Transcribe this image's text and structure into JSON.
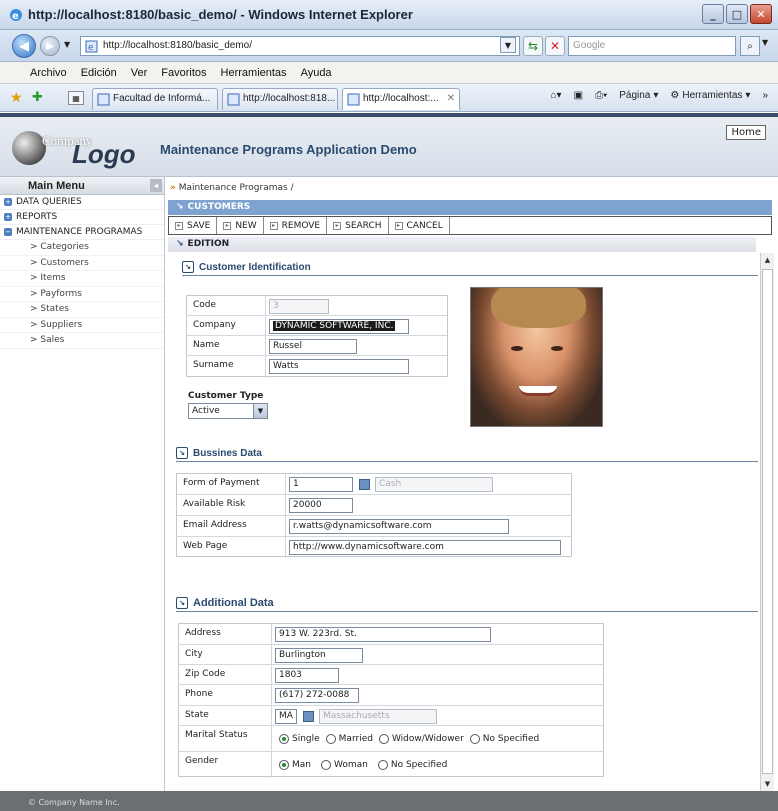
{
  "window": {
    "title": "http://localhost:8180/basic_demo/ - Windows Internet Explorer",
    "url": "http://localhost:8180/basic_demo/",
    "search_placeholder": "Google"
  },
  "menubar": [
    "Archivo",
    "Edición",
    "Ver",
    "Favoritos",
    "Herramientas",
    "Ayuda"
  ],
  "tabs": [
    {
      "label": "Facultad de Informá..."
    },
    {
      "label": "http://localhost:818..."
    },
    {
      "label": "http://localhost:..."
    }
  ],
  "toolbar_right": {
    "page": "Página",
    "tools": "Herramientas"
  },
  "app": {
    "logo_company": "Company",
    "logo_text": "Logo",
    "title": "Maintenance Programs Application Demo",
    "home": "Home",
    "footer": "© Company Name Inc."
  },
  "sidebar": {
    "header": "Main Menu",
    "items": [
      "DATA QUERIES",
      "REPORTS",
      "MAINTENANCE PROGRAMAS"
    ],
    "sub_items": [
      "> Categories",
      "> Customers",
      "> Items",
      "> Payforms",
      "> States",
      "> Suppliers",
      "> Sales"
    ]
  },
  "main": {
    "breadcrumb_arrows": "»",
    "breadcrumb": "Maintenance Programas /",
    "section": "CUSTOMERS",
    "buttons": [
      "SAVE",
      "NEW",
      "REMOVE",
      "SEARCH",
      "CANCEL"
    ],
    "edition": "EDITION"
  },
  "customer_identification": {
    "title": "Customer Identification",
    "code_label": "Code",
    "code": "3",
    "company_label": "Company",
    "company": "DYNAMIC SOFTWARE, INC.",
    "name_label": "Name",
    "name": "Russel",
    "surname_label": "Surname",
    "surname": "Watts",
    "type_label": "Customer Type",
    "type": "Active"
  },
  "business_data": {
    "title": "Bussines Data",
    "payment_label": "Form of Payment",
    "payment_code": "1",
    "payment_desc": "Cash",
    "risk_label": "Available Risk",
    "risk": "20000",
    "email_label": "Email Address",
    "email": "r.watts@dynamicsoftware.com",
    "web_label": "Web Page",
    "web": "http://www.dynamicsoftware.com"
  },
  "additional_data": {
    "title": "Additional Data",
    "address_label": "Address",
    "address": "913 W. 223rd. St.",
    "city_label": "City",
    "city": "Burlington",
    "zip_label": "Zip Code",
    "zip": "1803",
    "phone_label": "Phone",
    "phone": "(617) 272-0088",
    "state_label": "State",
    "state_code": "MA",
    "state_name": "Massachusetts",
    "marital_label": "Marital Status",
    "marital_options": [
      "Single",
      "Married",
      "Widow/Widower",
      "No Specified"
    ],
    "marital_selected": "Single",
    "gender_label": "Gender",
    "gender_options": [
      "Man",
      "Woman",
      "No Specified"
    ],
    "gender_selected": "Man"
  }
}
